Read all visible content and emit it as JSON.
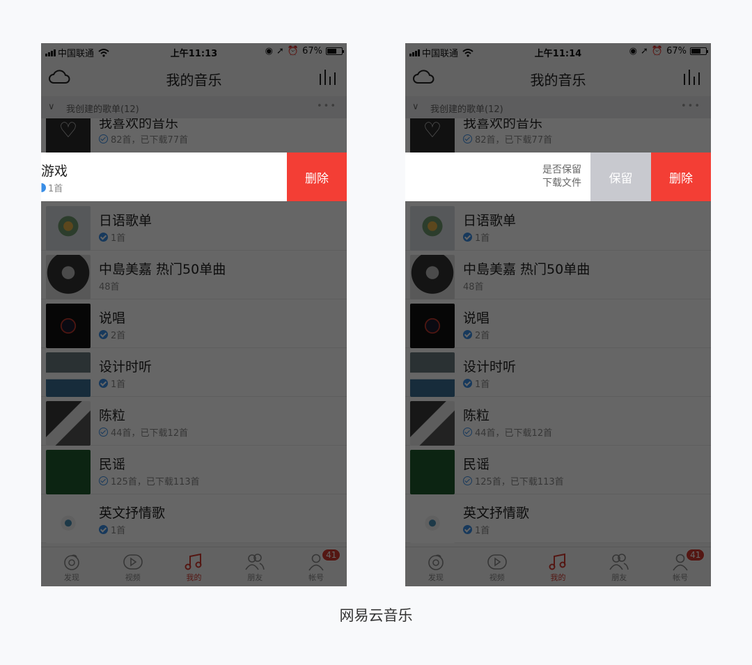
{
  "caption": "网易云音乐",
  "phones": [
    {
      "status": {
        "carrier": "中国联通",
        "time": "上午11:13",
        "battery": "67%",
        "battery_level": 0.67
      },
      "nav": {
        "title": "我的音乐"
      },
      "section": {
        "label": "我创建的歌单(12)"
      },
      "partial_item": {
        "name": "我喜欢的音乐",
        "sub": "82首，已下载77首"
      },
      "swipe_item": {
        "name": "游戏",
        "sub": "1首",
        "delete_label": "删除"
      },
      "items": [
        {
          "name": "日语歌单",
          "sub": "1首",
          "downloaded": true,
          "cover": "cover-flower"
        },
        {
          "name": "中島美嘉 热门50单曲",
          "sub": "48首",
          "downloaded": false,
          "cover": "cover-portrait"
        },
        {
          "name": "说唱",
          "sub": "2首",
          "downloaded": true,
          "cover": "cover-neon"
        },
        {
          "name": "设计时听",
          "sub": "1首",
          "downloaded": true,
          "cover": "cover-wave"
        },
        {
          "name": "陈粒",
          "sub": "44首，已下载12首",
          "downloaded": false,
          "cover": "cover-photo"
        },
        {
          "name": "民谣",
          "sub": "125首，已下载113首",
          "downloaded": false,
          "cover": "cover-green"
        },
        {
          "name": "英文抒情歌",
          "sub": "1首",
          "downloaded": true,
          "cover": "cover-eye"
        }
      ],
      "tabs": [
        {
          "label": "发现",
          "icon": "discover-icon"
        },
        {
          "label": "视频",
          "icon": "video-icon"
        },
        {
          "label": "我的",
          "icon": "music-note-icon",
          "active": true
        },
        {
          "label": "朋友",
          "icon": "friends-icon"
        },
        {
          "label": "帐号",
          "icon": "account-icon",
          "badge": "41"
        }
      ]
    },
    {
      "status": {
        "carrier": "中国联通",
        "time": "上午11:14",
        "battery": "67%",
        "battery_level": 0.67
      },
      "nav": {
        "title": "我的音乐"
      },
      "section": {
        "label": "我创建的歌单(12)"
      },
      "partial_item": {
        "name": "我喜欢的音乐",
        "sub": "82首，已下载77首"
      },
      "swipe_item": {
        "question_line1": "是否保留",
        "question_line2": "下载文件",
        "keep_label": "保留",
        "delete_label": "删除"
      },
      "items": [
        {
          "name": "日语歌单",
          "sub": "1首",
          "downloaded": true,
          "cover": "cover-flower"
        },
        {
          "name": "中島美嘉 热门50单曲",
          "sub": "48首",
          "downloaded": false,
          "cover": "cover-portrait"
        },
        {
          "name": "说唱",
          "sub": "2首",
          "downloaded": true,
          "cover": "cover-neon"
        },
        {
          "name": "设计时听",
          "sub": "1首",
          "downloaded": true,
          "cover": "cover-wave"
        },
        {
          "name": "陈粒",
          "sub": "44首，已下载12首",
          "downloaded": false,
          "cover": "cover-photo"
        },
        {
          "name": "民谣",
          "sub": "125首，已下载113首",
          "downloaded": false,
          "cover": "cover-green"
        },
        {
          "name": "英文抒情歌",
          "sub": "1首",
          "downloaded": true,
          "cover": "cover-eye"
        }
      ],
      "tabs": [
        {
          "label": "发现",
          "icon": "discover-icon"
        },
        {
          "label": "视频",
          "icon": "video-icon"
        },
        {
          "label": "我的",
          "icon": "music-note-icon",
          "active": true
        },
        {
          "label": "朋友",
          "icon": "friends-icon"
        },
        {
          "label": "帐号",
          "icon": "account-icon",
          "badge": "41"
        }
      ]
    }
  ],
  "colors": {
    "delete_red": "#f33e35",
    "keep_gray": "#c8c9cf",
    "active_tab": "#d33a31",
    "check_blue": "#3a8ee6",
    "page_bg": "#f8f9fb"
  }
}
